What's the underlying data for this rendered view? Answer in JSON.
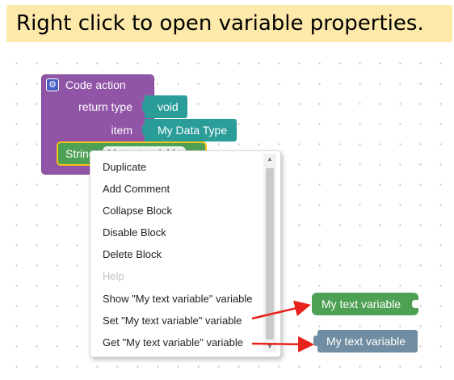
{
  "banner": {
    "text": "Right click to open variable properties."
  },
  "code_action": {
    "title": "Code action",
    "return_type_label": "return type",
    "return_type_value": "void",
    "item_label": "item",
    "item_value": "My Data Type",
    "string_label": "String",
    "string_variable": "My text variable"
  },
  "context_menu": {
    "items": [
      {
        "label": "Duplicate",
        "enabled": true
      },
      {
        "label": "Add Comment",
        "enabled": true
      },
      {
        "label": "Collapse Block",
        "enabled": true
      },
      {
        "label": "Disable Block",
        "enabled": true
      },
      {
        "label": "Delete Block",
        "enabled": true
      },
      {
        "label": "Help",
        "enabled": false
      },
      {
        "label": "Show \"My text variable\" variable",
        "enabled": true
      },
      {
        "label": "Set \"My text variable\" variable",
        "enabled": true
      },
      {
        "label": "Get \"My text variable\" variable",
        "enabled": true
      }
    ]
  },
  "variable_blocks": {
    "set_label": "My text variable",
    "get_label": "My text variable"
  },
  "colors": {
    "banner": "#fde9a9",
    "procedure_block": "#9155a7",
    "type_block": "#2a9d99",
    "string_block": "#4ea054",
    "getter_block": "#708da1",
    "selection_outline": "#f5c518",
    "arrow": "#e8211b"
  }
}
